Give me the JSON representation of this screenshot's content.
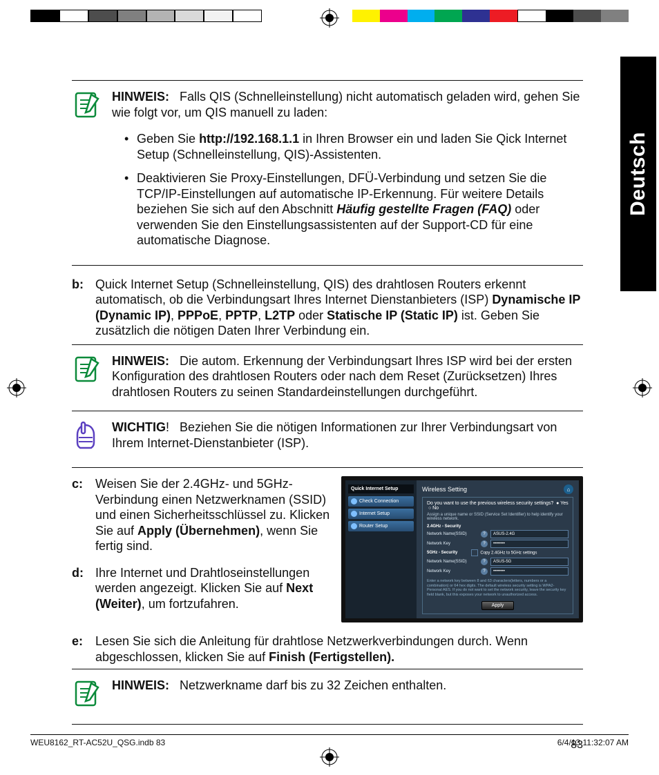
{
  "lang_tab": "Deutsch",
  "page_number": "83",
  "footer_left": "WEU8162_RT-AC52U_QSG.indb   83",
  "footer_right": "6/4/13   11:32:07 AM",
  "note1": {
    "label": "HINWEIS:",
    "text": "Falls QIS (Schnelleinstellung) nicht automatisch geladen wird, gehen Sie wie folgt vor, um QIS manuell zu laden:"
  },
  "bullet1_pre": "Geben Sie ",
  "bullet1_bold": "http://192.168.1.1",
  "bullet1_post": " in Ihren Browser ein und laden Sie Qick Internet Setup (Schnelleinstellung, QIS)-Assistenten.",
  "bullet2_pre": "Deaktivieren Sie Proxy-Einstellungen, DFÜ-Verbindung und setzen Sie die TCP/IP-Einstellungen auf automatische IP-Erkennung. Für weitere Details beziehen Sie sich auf den Abschnitt ",
  "bullet2_bi": "Häufig gestellte Fragen (FAQ)",
  "bullet2_post": " oder verwenden Sie den Einstellungsassistenten auf der Support-CD für eine automatische Diagnose.",
  "b_label": "b:",
  "b_pre": "Quick Internet Setup (Schnelleinstellung, QIS) des drahtlosen Routers erkennt automatisch, ob die Verbindungsart Ihres Internet Dienstanbieters (ISP) ",
  "b_b1": "Dynamische IP (Dynamic IP)",
  "b_s1": ", ",
  "b_b2": "PPPoE",
  "b_s2": ", ",
  "b_b3": "PPTP",
  "b_s3": ", ",
  "b_b4": "L2TP",
  "b_s4": " oder ",
  "b_b5": "Statische IP (Static IP)",
  "b_post": " ist. Geben Sie zusätzlich die nötigen Daten Ihrer Verbindung ein.",
  "note2": {
    "label": "HINWEIS:",
    "text": "Die autom. Erkennung der Verbindungsart Ihres ISP wird bei der ersten Konfiguration des drahtlosen Routers oder nach dem Reset (Zurücksetzen) Ihres drahtlosen Routers zu seinen Standardein­stellungen durchgeführt."
  },
  "important": {
    "label": "WICHTIG",
    "excl": "!",
    "text": "Beziehen Sie die nötigen Informationen zur Ihrer Verbin­dungsart von Ihrem Internet-Dienstanbieter (ISP)."
  },
  "c_label": "c:",
  "c_pre": "Weisen Sie der 2.4GHz- und 5GHz-Verbindung einen Netzwerknamen (SSID) und einen Sicherheitsschlüs­sel zu. Klicken Sie auf ",
  "c_bold": "Apply (Über­nehmen)",
  "c_post": ", wenn Sie fertig sind.",
  "d_label": "d:",
  "d_pre": "Ihre Internet und Drahtloseinstel­lungen werden angezeigt. Klicken Sie auf ",
  "d_bold": "Next (Weiter)",
  "d_post": ", um fortzufah­ren.",
  "e_label": "e:",
  "e_pre": "Lesen Sie sich die Anleitung für drahtlose Netzwerkverbindungen durch. Wenn abgeschlossen, klicken Sie auf ",
  "e_bold": "Finish (Fertigstellen).",
  "note3": {
    "label": "HINWEIS:",
    "text": "Netzwerkname darf bis zu 32 Zeichen enthalten."
  },
  "shot": {
    "qis": "Quick Internet Setup",
    "step1": "Check Connection",
    "step2": "Internet Setup",
    "step3": "Router Setup",
    "title": "Wireless Setting",
    "q": "Do you want to use the previous wireless security settings?",
    "yes": "Yes",
    "no": "No",
    "hint": "Assign a unique name or SSID (Service Set Identifier) to help identify your wireless network.",
    "sec24": "2.4GHz - Security",
    "name_lbl": "Network Name(SSID)",
    "key_lbl": "Network Key",
    "name24_val": "ASUS-2.4G",
    "key_dots": "••••••••",
    "sec5": "5GHz - Security",
    "copy": "Copy 2.4GHz to 5GHz settings",
    "name5_val": "ASUS-5G",
    "note": "Enter a network key between 8 and 63 characters(letters, numbers or a combination) or 64 hex digits. The default wireless security setting is WPA2-Personal AES. If you do not want to set the network security, leave the security key field blank, but this exposes your network to unauthorized access.",
    "apply": "Apply"
  },
  "colors": {
    "left": [
      "#000",
      "#ffffff",
      "#4d4d4d",
      "#808080",
      "#b3b3b3",
      "#d9d9d9",
      "#f2f2f2",
      "#ffffff"
    ],
    "right": [
      "#fff200",
      "#ec008c",
      "#00aeef",
      "#00a651",
      "#2e3192",
      "#ed1c24",
      "#fff",
      "#000",
      "#4d4d4d",
      "#808080"
    ]
  }
}
